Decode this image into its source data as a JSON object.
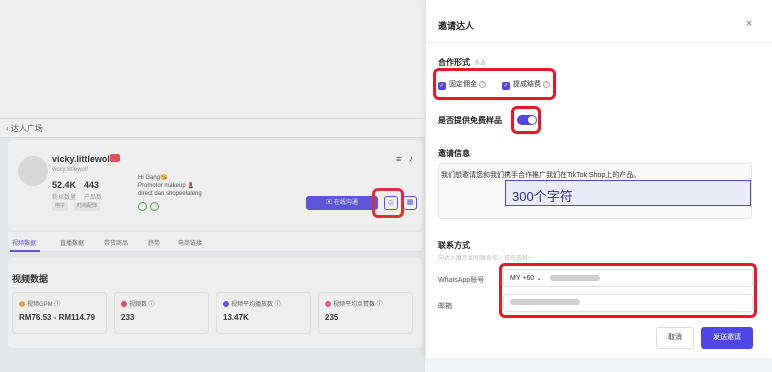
{
  "breadcrumb": {
    "label": "‹ 达人广场"
  },
  "creator": {
    "name": "vicky.littlewolf",
    "username": "vicky.littlewolf",
    "followers": "52.4K",
    "followers_label": "粉丝数量",
    "products": "443",
    "products_label": "产品数",
    "tags": [
      "电子",
      "时尚配饰"
    ],
    "bio_line1": "Hi Gang😘",
    "bio_line2": "Promotor makeup 💄",
    "bio_line3": "direct dan shopeelaleng"
  },
  "actions": {
    "invite_label": "▣ 在线沟通",
    "user_icon": "person-icon",
    "calendar_icon": "calendar-icon"
  },
  "tabs": [
    "视频数据",
    "直播数据",
    "带货商品",
    "趋势",
    "电商链接"
  ],
  "video": {
    "title": "视频数据",
    "cards": [
      {
        "label": "视频GPM ⓘ",
        "value": "RM76.53 - RM114.79",
        "color": "#f5a623"
      },
      {
        "label": "视频数 ⓘ",
        "value": "233",
        "color": "#ef3e4d"
      },
      {
        "label": "视频平均播放数 ⓘ",
        "value": "13.47K",
        "color": "#5046e5"
      },
      {
        "label": "视频平均点赞数 ⓘ",
        "value": "235",
        "color": "#e8518f"
      }
    ]
  },
  "modal": {
    "title": "邀请达人",
    "close": "×",
    "coop_title": "合作形式",
    "coop_sub": "多选",
    "option1": "固定佣金",
    "option2": "提成结费",
    "sample_title": "是否提供免费样品",
    "info_title": "邀请信息",
    "message": "我们想邀请您和我们携手合作推广我们在TikTok Shop上的产品。",
    "char_hint": "300个字符",
    "contact_title": "联系方式",
    "contact_sub": "向达人展示如何联系你，可任选其一",
    "whatsapp_label": "WhatsApp账号",
    "whatsapp_value": "MY +60 ⌄",
    "email_label": "邮箱",
    "cancel": "取消",
    "send": "发送邀请"
  }
}
